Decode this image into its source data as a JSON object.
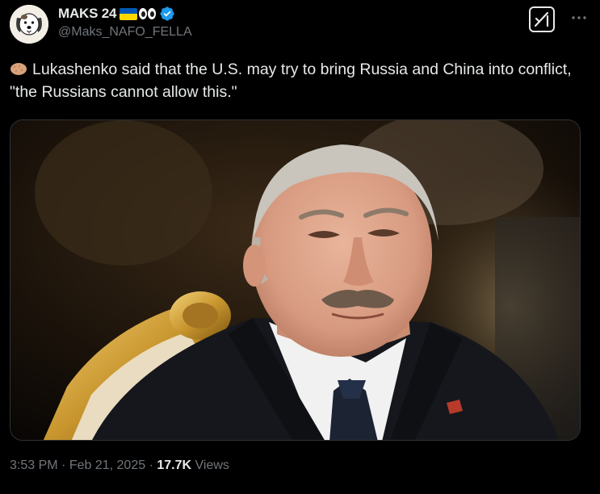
{
  "author": {
    "display_name": "MAKS 24",
    "handle": "@Maks_NAFO_FELLA"
  },
  "icons": {
    "flag": "ukraine-flag-icon",
    "eyes": "eyes-emoji-icon",
    "verified": "verified-badge-icon",
    "grok": "grok-icon",
    "more": "more-options-icon",
    "potato": "potato-emoji-icon"
  },
  "colors": {
    "background": "#000000",
    "text": "#e7e9ea",
    "secondary_text": "#71767b",
    "verified_blue": "#1d9bf0",
    "flag_blue": "#0057b7",
    "flag_yellow": "#ffd700"
  },
  "tweet": {
    "text": "Lukashenko said that the U.S. may try to bring Russia and China into conflict, \"the Russians cannot allow this.\""
  },
  "media": {
    "kind": "photo"
  },
  "footer": {
    "time": "3:53 PM",
    "separator1": "·",
    "date": "Feb 21, 2025",
    "separator2": "·",
    "views_count": "17.7K",
    "views_label": "Views"
  }
}
